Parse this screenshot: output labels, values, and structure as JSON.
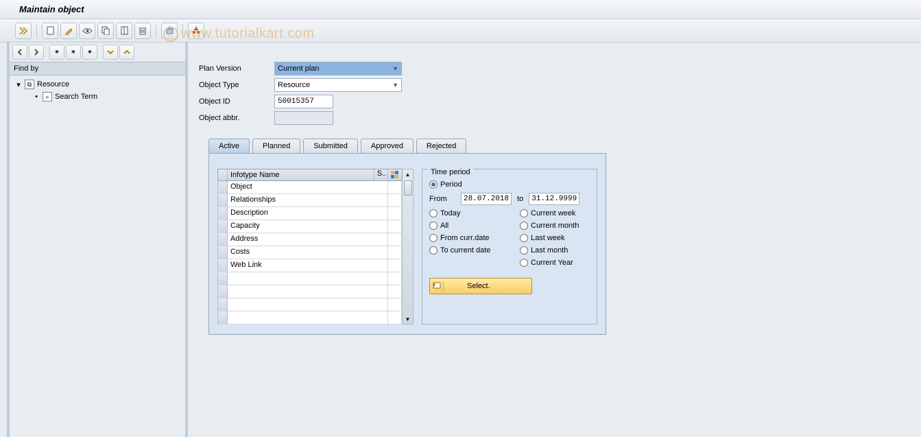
{
  "title": "Maintain object",
  "watermark": "www.tutorialkart.com",
  "toolbar_icons": {
    "execute": "execute-icon",
    "create": "create-icon",
    "change": "change-icon",
    "display": "display-icon",
    "copy": "copy-icon",
    "delimit": "delimit-icon",
    "delete": "delete-icon",
    "overview": "overview-icon",
    "where_used": "where-used-icon"
  },
  "findby_label": "Find by",
  "tree": {
    "resource": "Resource",
    "search_term": "Search Term"
  },
  "fields": {
    "plan_version_label": "Plan Version",
    "plan_version_value": "Current plan",
    "object_type_label": "Object Type",
    "object_type_value": "Resource",
    "object_id_label": "Object ID",
    "object_id_value": "50015357",
    "object_abbr_label": "Object abbr.",
    "object_abbr_value": ""
  },
  "tabs": {
    "active": "Active",
    "planned": "Planned",
    "submitted": "Submitted",
    "approved": "Approved",
    "rejected": "Rejected"
  },
  "infotype_header": {
    "name": "Infotype Name",
    "s": "S.."
  },
  "infotypes": [
    "Object",
    "Relationships",
    "Description",
    "Capacity",
    "Address",
    "Costs",
    "Web Link",
    "",
    "",
    "",
    ""
  ],
  "time_period": {
    "title": "Time period",
    "period": "Period",
    "from_label": "From",
    "from_value": "28.07.2018",
    "to_label": "to",
    "to_value": "31.12.9999",
    "today": "Today",
    "current_week": "Current week",
    "all": "All",
    "current_month": "Current month",
    "from_curr_date": "From curr.date",
    "last_week": "Last week",
    "to_current_date": "To current date",
    "last_month": "Last month",
    "current_year": "Current Year"
  },
  "select_button": "Select."
}
